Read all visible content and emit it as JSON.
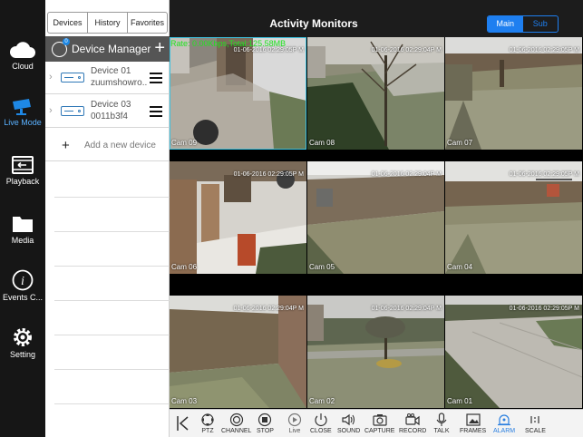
{
  "sidebar": {
    "items": [
      {
        "label": "Cloud",
        "icon": "cloud-icon"
      },
      {
        "label": "Live Mode",
        "icon": "camera-icon"
      },
      {
        "label": "Playback",
        "icon": "film-icon"
      },
      {
        "label": "Media",
        "icon": "folder-icon"
      },
      {
        "label": "Events C...",
        "icon": "info-icon"
      },
      {
        "label": "Setting",
        "icon": "gear-icon"
      }
    ],
    "active_index": 1
  },
  "device_panel": {
    "tabs": [
      "Devices",
      "History",
      "Favorites"
    ],
    "header_title": "Device Manager",
    "header_badge": "0",
    "add_symbol": "+",
    "devices": [
      {
        "name": "Device 01",
        "subtitle": "zuumshowro..."
      },
      {
        "name": "Device 03",
        "subtitle": "0011b3f4"
      }
    ],
    "add_device_label": "Add a new device"
  },
  "topbar": {
    "title": "Activity Monitors",
    "stream_options": [
      "Main",
      "Sub"
    ],
    "stream_selected": "Main"
  },
  "grid": {
    "bitrate_text": "Rate: 0.00Kbps,Total:125.58MB",
    "cameras": [
      {
        "name": "Cam 09",
        "timestamp": "01-06-2016 02:29:05P M",
        "selected": true
      },
      {
        "name": "Cam 08",
        "timestamp": "01-06-2016 02:29:04P M",
        "selected": false
      },
      {
        "name": "Cam 07",
        "timestamp": "01-06-2016 02:29:05P M",
        "selected": false
      },
      {
        "name": "Cam 06",
        "timestamp": "01-06-2016 02:29:05P M",
        "selected": false
      },
      {
        "name": "Cam 05",
        "timestamp": "01-06-2016 02:29:04P M",
        "selected": false
      },
      {
        "name": "Cam 04",
        "timestamp": "01-06-2016 02:29:05P M",
        "selected": false
      },
      {
        "name": "Cam 03",
        "timestamp": "01-06-2016 02:29:04P M",
        "selected": false
      },
      {
        "name": "Cam 02",
        "timestamp": "01-06-2016 02:29:04P M",
        "selected": false
      },
      {
        "name": "Cam 01",
        "timestamp": "01-06-2016 02:29:05P M",
        "selected": false
      }
    ]
  },
  "toolbar": {
    "items": [
      {
        "label": "PTZ",
        "icon": "ptz-icon"
      },
      {
        "label": "CHANNEL",
        "icon": "channel-icon"
      },
      {
        "label": "STOP",
        "icon": "stop-icon"
      },
      {
        "label": "Live",
        "icon": "play-icon"
      },
      {
        "label": "CLOSE",
        "icon": "power-icon"
      },
      {
        "label": "SOUND",
        "icon": "speaker-icon"
      },
      {
        "label": "CAPTURE",
        "icon": "camera-capture-icon"
      },
      {
        "label": "RECORD",
        "icon": "video-record-icon"
      },
      {
        "label": "TALK",
        "icon": "microphone-icon"
      },
      {
        "label": "FRAMES",
        "icon": "frames-icon"
      },
      {
        "label": "ALARM",
        "icon": "alarm-icon"
      },
      {
        "label": "SCALE",
        "icon": "scale-icon"
      }
    ],
    "active_label": "ALARM",
    "collapse_icon": "collapse-left-icon"
  },
  "colors": {
    "accent": "#1e7ff0",
    "rate_text": "#21e321",
    "selected_border": "#3cc3e0",
    "header_bg": "#555555"
  }
}
